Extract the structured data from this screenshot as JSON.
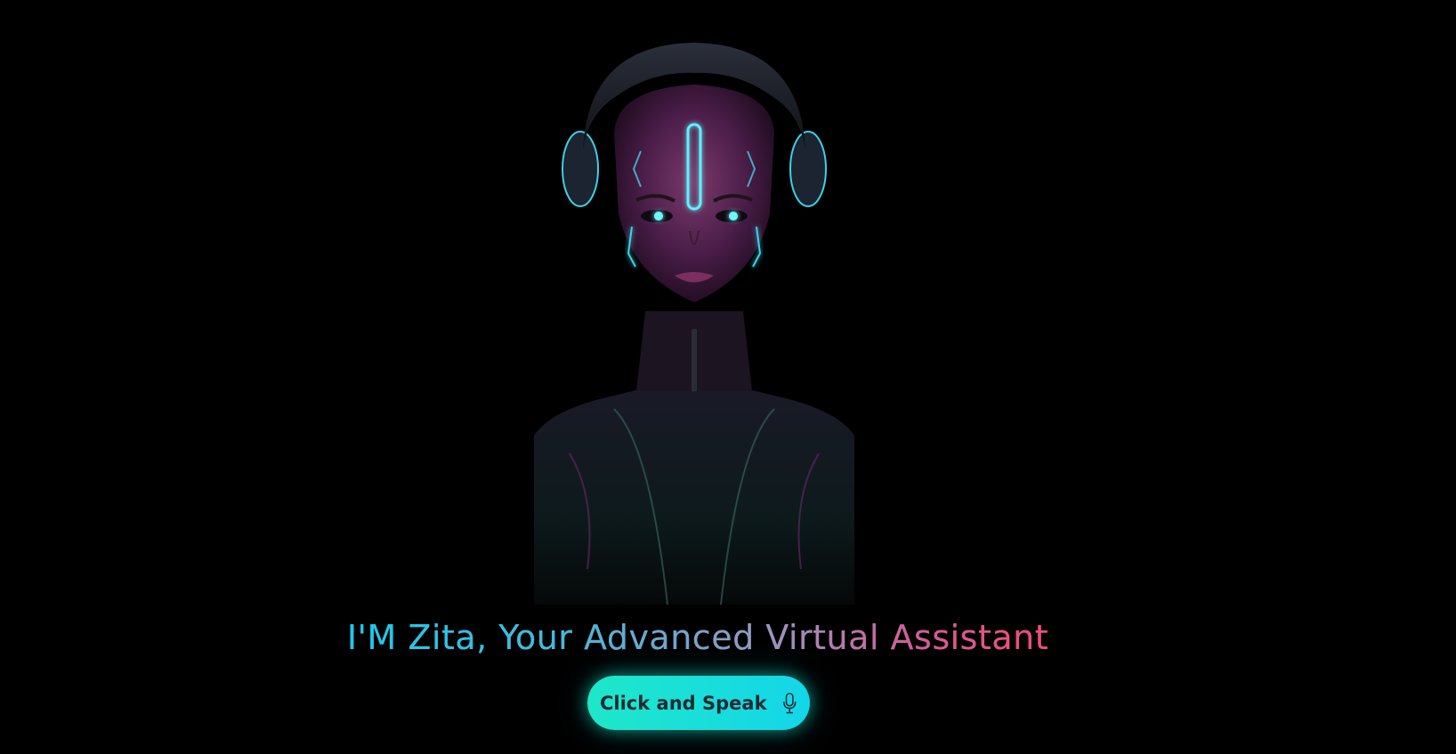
{
  "hero": {
    "title": "I'M Zita, Your Advanced Virtual Assistant"
  },
  "button": {
    "label": "Click and Speak",
    "icon": "microphone-icon"
  },
  "colors": {
    "background": "#000000",
    "title_gradient_start": "#1fc8e8",
    "title_gradient_end": "#f04a7a",
    "button_gradient_start": "#1ee7c8",
    "button_gradient_end": "#14d6ea",
    "button_text": "#1b2a33"
  },
  "avatar": {
    "description_icon": "cyborg-avatar-image"
  }
}
